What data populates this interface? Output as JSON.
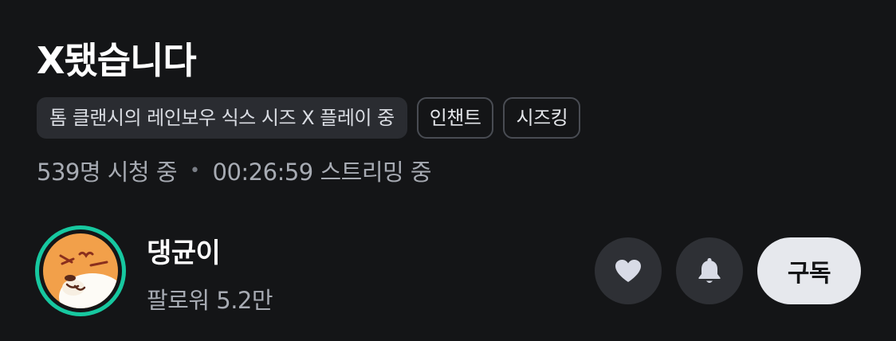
{
  "stream": {
    "title": "X됐습니다",
    "category": "톰 클랜시의 레인보우 식스 시즈 X 플레이 중",
    "tags": [
      "인챈트",
      "시즈킹"
    ],
    "viewers": "539명 시청 중",
    "separator": "•",
    "uptime": "00:26:59 스트리밍 중"
  },
  "channel": {
    "name": "댕균이",
    "followers": "팔로워 5.2만",
    "avatar_ring_color": "#17c8a0"
  },
  "actions": {
    "like_icon": "heart-icon",
    "notify_icon": "bell-icon",
    "subscribe_label": "구독"
  },
  "colors": {
    "background": "#141517",
    "icon_fill": "#d8dbe6",
    "subscribe_bg": "#e6e8ed"
  }
}
